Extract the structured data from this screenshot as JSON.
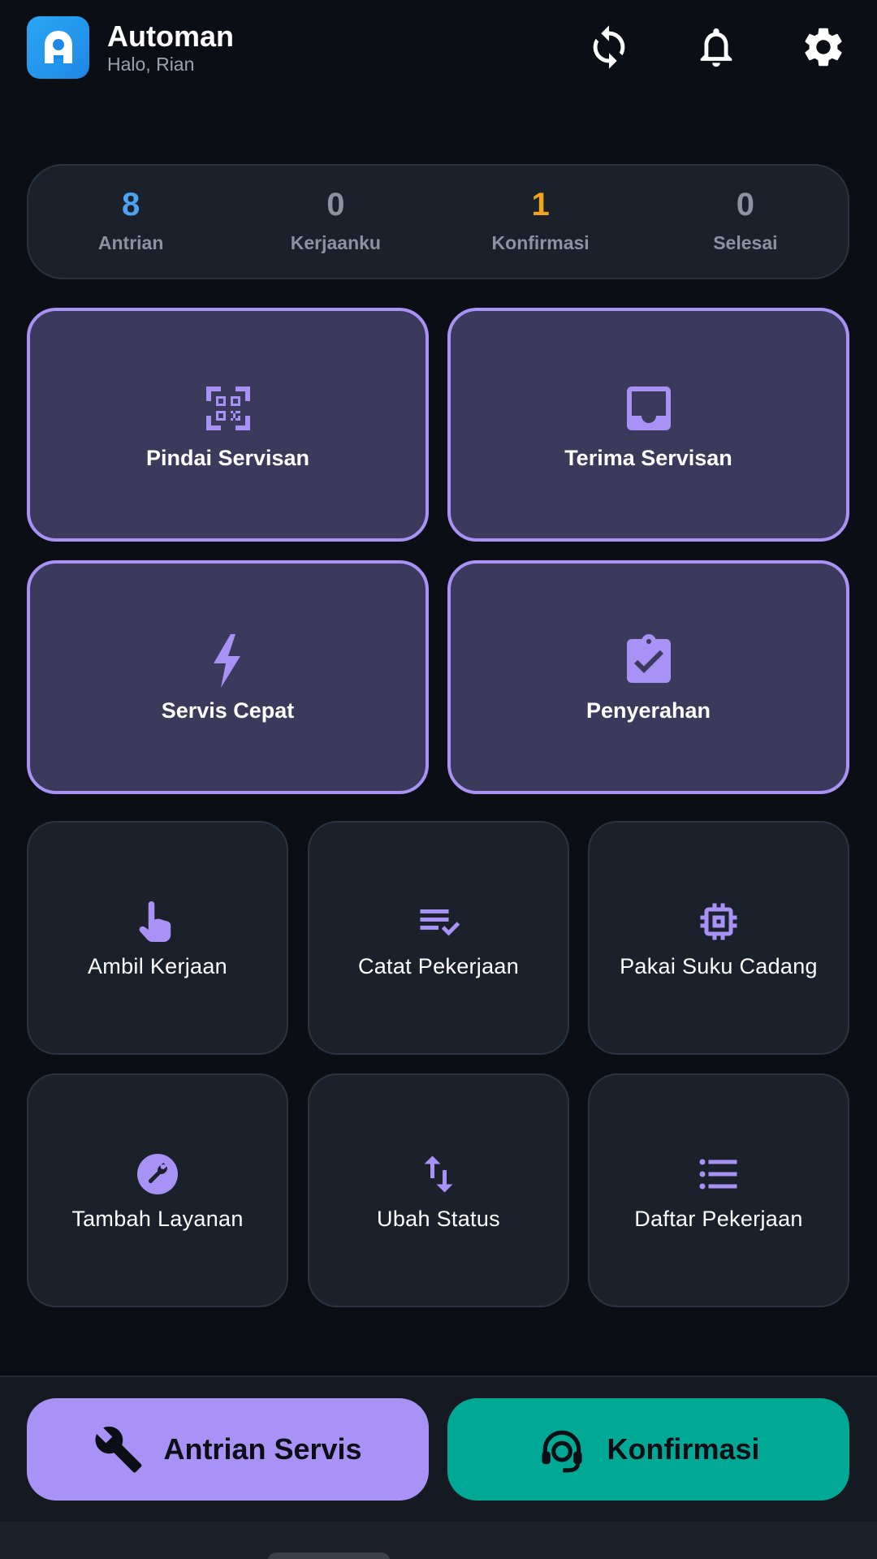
{
  "app": {
    "title": "Automan",
    "greeting": "Halo, Rian"
  },
  "header_icons": [
    "sync-icon",
    "bell-icon",
    "gear-icon"
  ],
  "stats": [
    {
      "value": "8",
      "label": "Antrian",
      "color": "#4ea3f1"
    },
    {
      "value": "0",
      "label": "Kerjaanku",
      "color": "#8b93a0"
    },
    {
      "value": "1",
      "label": "Konfirmasi",
      "color": "#f0a41c"
    },
    {
      "value": "0",
      "label": "Selesai",
      "color": "#8b93a0"
    }
  ],
  "primary_actions": [
    {
      "label": "Pindai Servisan",
      "icon": "qr-scan-icon"
    },
    {
      "label": "Terima Servisan",
      "icon": "inbox-icon"
    },
    {
      "label": "Servis Cepat",
      "icon": "lightning-icon"
    },
    {
      "label": "Penyerahan",
      "icon": "clipboard-check-icon"
    }
  ],
  "secondary_actions": [
    {
      "label": "Ambil Kerjaan",
      "icon": "hand-pointer-icon"
    },
    {
      "label": "Catat Pekerjaan",
      "icon": "list-check-icon"
    },
    {
      "label": "Pakai Suku Cadang",
      "icon": "chip-icon"
    },
    {
      "label": "Tambah Layanan",
      "icon": "wrench-circle-icon"
    },
    {
      "label": "Ubah Status",
      "icon": "swap-vertical-icon"
    },
    {
      "label": "Daftar Pekerjaan",
      "icon": "list-icon"
    }
  ],
  "bottom": {
    "queue_label": "Antrian Servis",
    "confirm_label": "Konfirmasi"
  },
  "colors": {
    "accent": "#a892f5",
    "teal": "#00a896",
    "background": "#0b0e14",
    "card": "#1b212b"
  }
}
